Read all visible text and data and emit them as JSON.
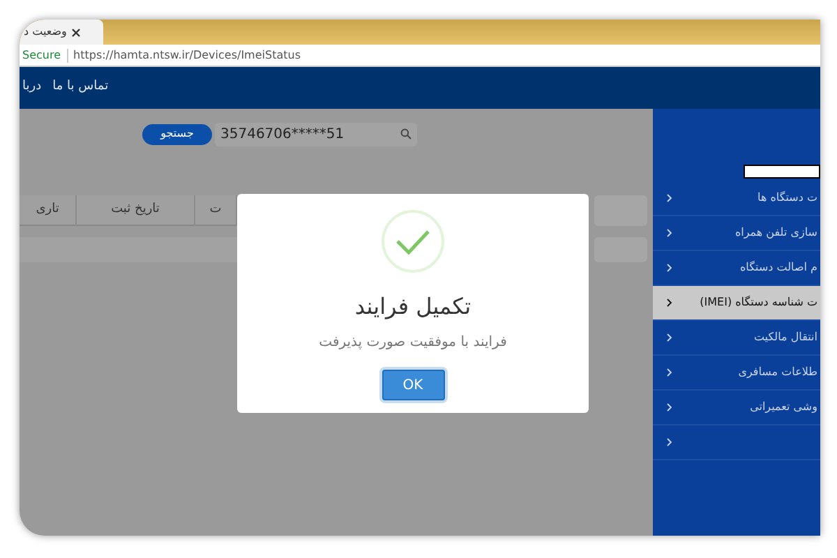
{
  "browser": {
    "tab": {
      "title": "وضعیت د"
    },
    "address": {
      "secure_label": "Secure",
      "url": "https://hamta.ntsw.ir/Devices/ImeiStatus"
    }
  },
  "nav": {
    "links": [
      "تماس با ما",
      "دربا"
    ]
  },
  "search": {
    "button": "جستجو",
    "value": "35746706*****51"
  },
  "table": {
    "columns": [
      "ت",
      "تاریخ ثبت",
      "تاری"
    ]
  },
  "sidebar": {
    "items": [
      {
        "label": "ت دستگاه ها",
        "selected": false
      },
      {
        "label": "سازی تلفن همراه",
        "selected": false
      },
      {
        "label": "م اصالت دستگاه",
        "selected": false
      },
      {
        "label": "ت شناسه دستگاه (IMEI)",
        "selected": true
      },
      {
        "label": "انتقال مالکیت",
        "selected": false
      },
      {
        "label": "طلاعات مسافری",
        "selected": false
      },
      {
        "label": "وشی تعمیراتی",
        "selected": false
      },
      {
        "selected": false
      }
    ]
  },
  "dialog": {
    "title": "تکمیل فرایند",
    "message": "فرایند با موفقیت صورت پذیرفت",
    "button": "OK"
  }
}
